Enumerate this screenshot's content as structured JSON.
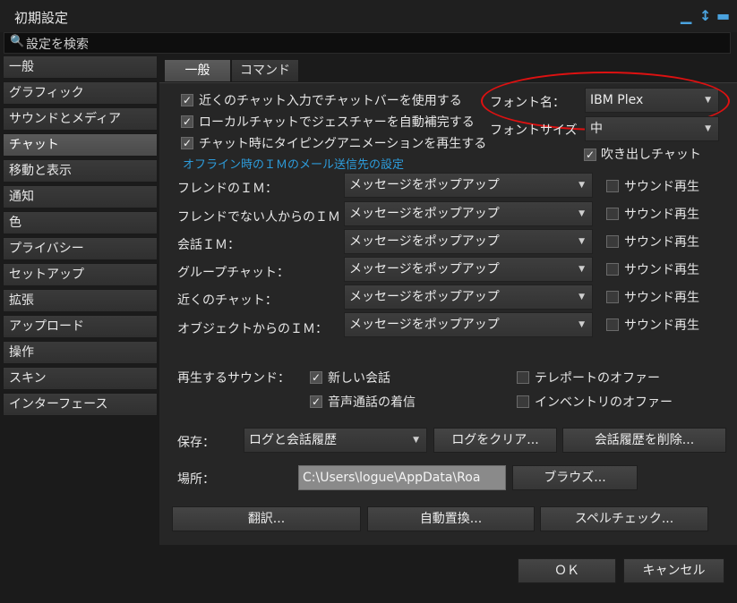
{
  "window": {
    "title": "初期設定",
    "minimize_icon": "minimize-icon",
    "pin_icon": "pin-icon",
    "close_icon": "close-icon"
  },
  "search": {
    "placeholder": "設定を検索",
    "icon": "search-icon"
  },
  "sidebar": {
    "items": [
      {
        "label": "一般"
      },
      {
        "label": "グラフィック"
      },
      {
        "label": "サウンドとメディア"
      },
      {
        "label": "チャット",
        "active": true
      },
      {
        "label": "移動と表示"
      },
      {
        "label": "通知"
      },
      {
        "label": "色"
      },
      {
        "label": "プライバシー"
      },
      {
        "label": "セットアップ"
      },
      {
        "label": "拡張"
      },
      {
        "label": "アップロード"
      },
      {
        "label": "操作"
      },
      {
        "label": "スキン"
      },
      {
        "label": "インターフェース"
      }
    ]
  },
  "tabs": [
    {
      "label": "一般",
      "active": true
    },
    {
      "label": "コマンド"
    }
  ],
  "options": {
    "nearby_chatbar": "近くのチャット入力でチャットバーを使用する",
    "local_gesture": "ローカルチャットでジェスチャーを自動補完する",
    "typing_anim": "チャット時にタイピングアニメーションを再生する",
    "offline_im_link": "オフライン時のＩＭのメール送信先の設定"
  },
  "font": {
    "name_label": "フォント名：",
    "name_value": "IBM Plex",
    "size_label": "フォントサイズ",
    "size_value": "中",
    "bubble_label": "吹き出しチャット"
  },
  "im_rows": [
    {
      "label": "フレンドのＩＭ：",
      "value": "メッセージをポップアップ",
      "sound": "サウンド再生"
    },
    {
      "label": "フレンドでない人からのＩＭ",
      "value": "メッセージをポップアップ",
      "sound": "サウンド再生"
    },
    {
      "label": "会話ＩＭ：",
      "value": "メッセージをポップアップ",
      "sound": "サウンド再生"
    },
    {
      "label": "グループチャット：",
      "value": "メッセージをポップアップ",
      "sound": "サウンド再生"
    },
    {
      "label": "近くのチャット：",
      "value": "メッセージをポップアップ",
      "sound": "サウンド再生"
    },
    {
      "label": "オブジェクトからのＩＭ：",
      "value": "メッセージをポップアップ",
      "sound": "サウンド再生"
    }
  ],
  "sounds": {
    "label": "再生するサウンド：",
    "new_conv": "新しい会話",
    "voice_call": "音声通話の着信",
    "teleport": "テレポートのオファー",
    "inventory": "インベントリのオファー"
  },
  "save": {
    "label": "保存：",
    "value": "ログと会話履歴",
    "clear_log": "ログをクリア...",
    "delete_history": "会話履歴を削除..."
  },
  "location": {
    "label": "場所：",
    "path": "C:\\Users\\logue\\AppData\\Roa",
    "browse": "ブラウズ..."
  },
  "tools": {
    "translate": "翻訳...",
    "autoreplace": "自動置換...",
    "spellcheck": "スペルチェック..."
  },
  "footer": {
    "ok": "ＯＫ",
    "cancel": "キャンセル"
  },
  "colors": {
    "accent_link": "#2d9cdb",
    "title_icons": "#4aa3df",
    "annotation": "#dd1111"
  }
}
